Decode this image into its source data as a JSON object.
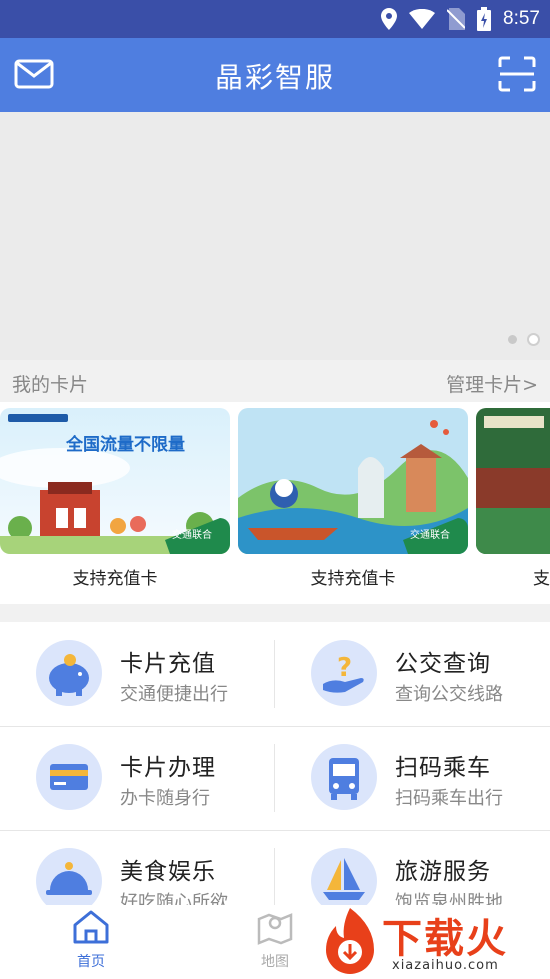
{
  "status_bar": {
    "time": "8:57"
  },
  "header": {
    "title": "晶彩智服"
  },
  "my_cards": {
    "heading": "我的卡片",
    "manage": "管理卡片>",
    "cards": [
      {
        "label": "支持充值卡",
        "art_text": "全国流量不限量",
        "badge": "交通联合"
      },
      {
        "label": "支持充值卡",
        "art_text": "",
        "badge": "交通联合"
      },
      {
        "label": "支",
        "art_text": "",
        "badge": ""
      }
    ]
  },
  "services": [
    {
      "name": "卡片充值",
      "desc": "交通便捷出行",
      "icon": "piggy-bank-icon"
    },
    {
      "name": "公交查询",
      "desc": "查询公交线路",
      "icon": "question-hand-icon"
    },
    {
      "name": "卡片办理",
      "desc": "办卡随身行",
      "icon": "card-icon"
    },
    {
      "name": "扫码乘车",
      "desc": "扫码乘车出行",
      "icon": "bus-icon"
    },
    {
      "name": "美食娱乐",
      "desc": "好吃随心所欲",
      "icon": "food-cloche-icon"
    },
    {
      "name": "旅游服务",
      "desc": "饱览泉州胜地",
      "icon": "sailboat-icon"
    }
  ],
  "bottom_nav": [
    {
      "label": "首页",
      "active": true
    },
    {
      "label": "地图",
      "active": false
    }
  ],
  "watermark": {
    "brand": "下载火",
    "url": "xiazaihuo.com"
  },
  "colors": {
    "header": "#4f7ee0",
    "status_bar": "#3a4fa8",
    "accent": "#3d6fd8"
  }
}
